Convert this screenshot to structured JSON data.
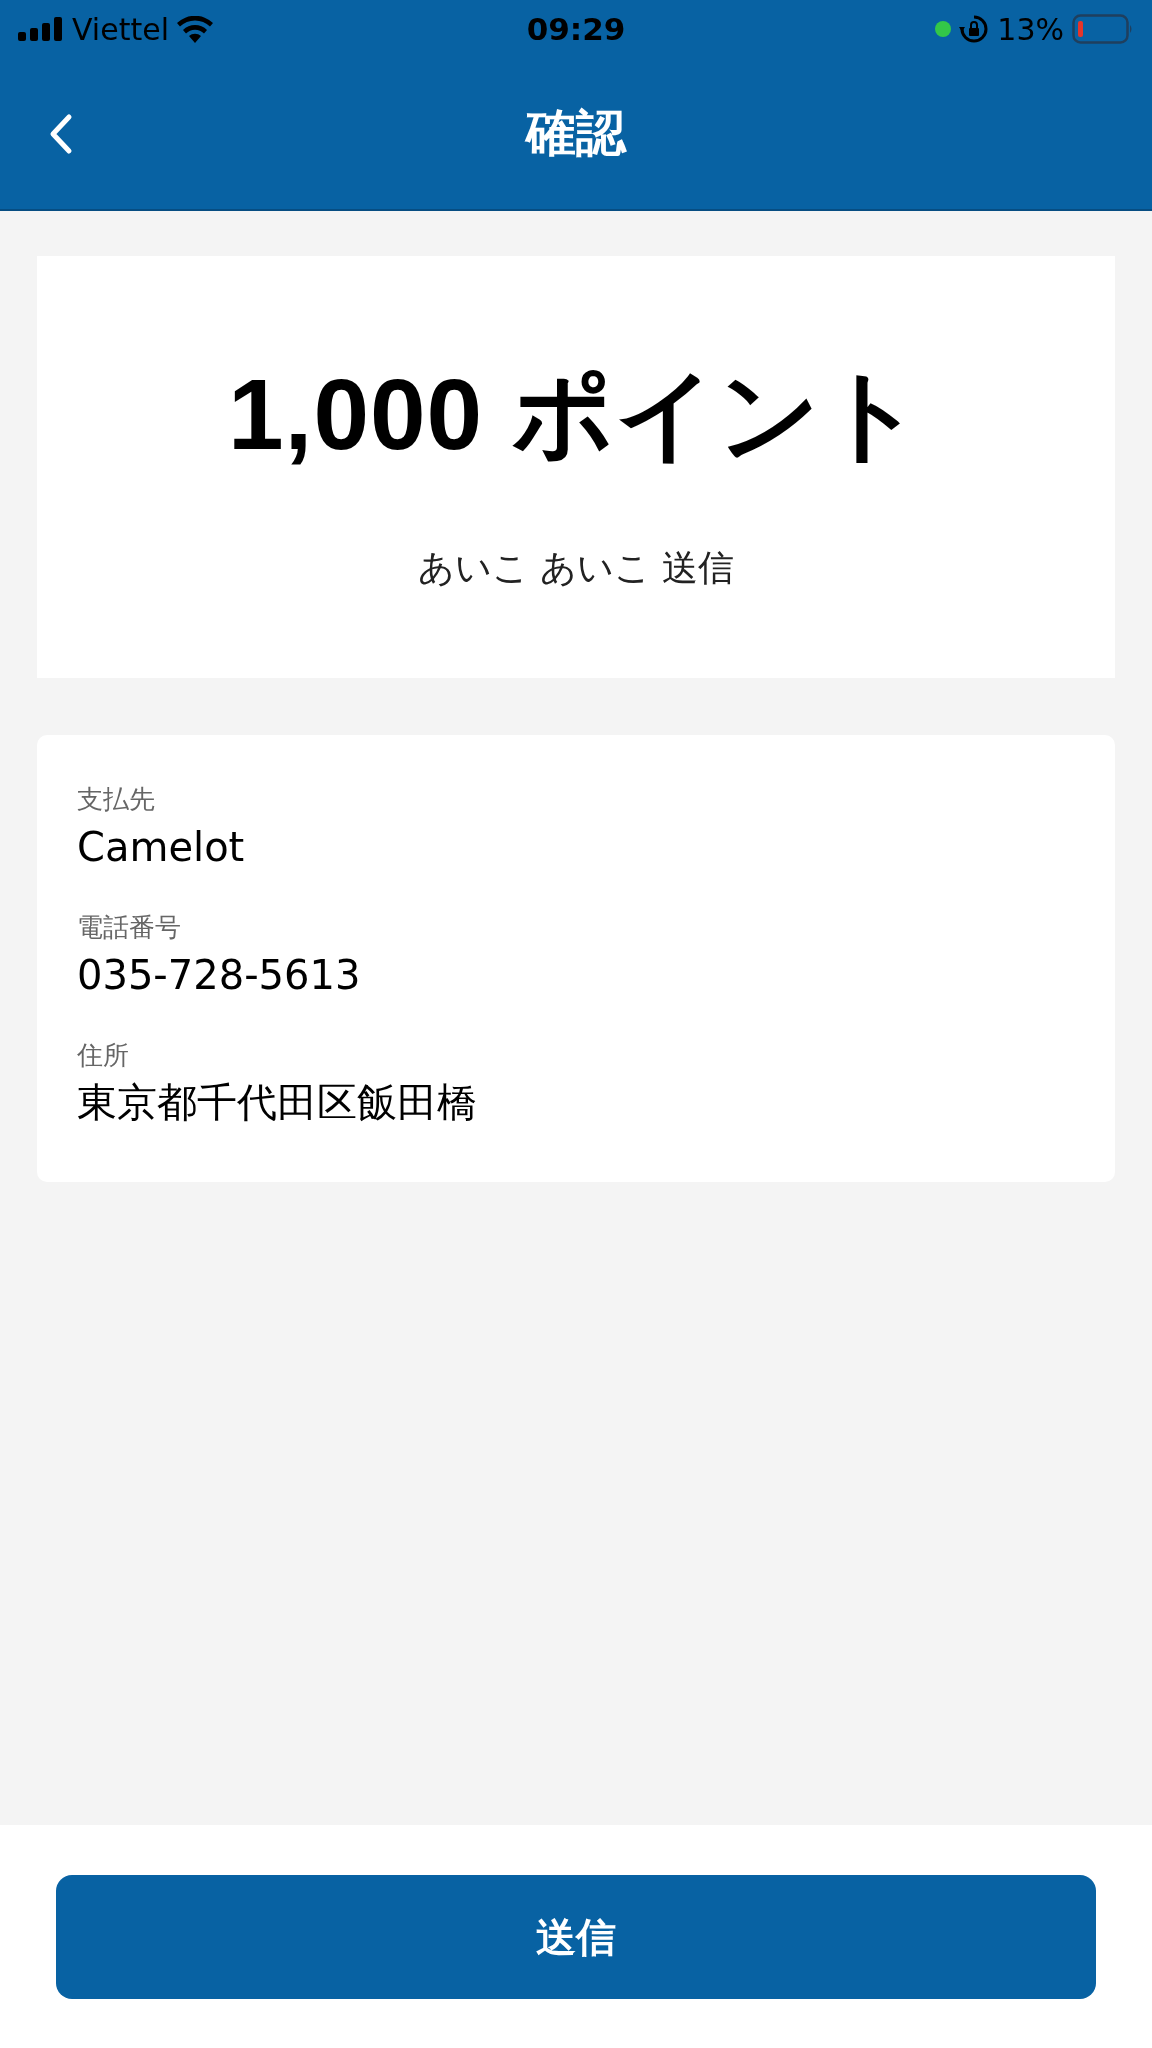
{
  "status_bar": {
    "carrier": "Viettel",
    "time": "09:29",
    "battery_percent": "13%"
  },
  "header": {
    "title": "確認"
  },
  "amount_card": {
    "amount": "1,000 ポイント",
    "subtitle": "あいこ あいこ 送信"
  },
  "details": [
    {
      "label": "支払先",
      "value": "Camelot"
    },
    {
      "label": "電話番号",
      "value": "035-728-5613"
    },
    {
      "label": "住所",
      "value": "東京都千代田区飯田橋"
    }
  ],
  "submit_button": {
    "label": "送信"
  }
}
